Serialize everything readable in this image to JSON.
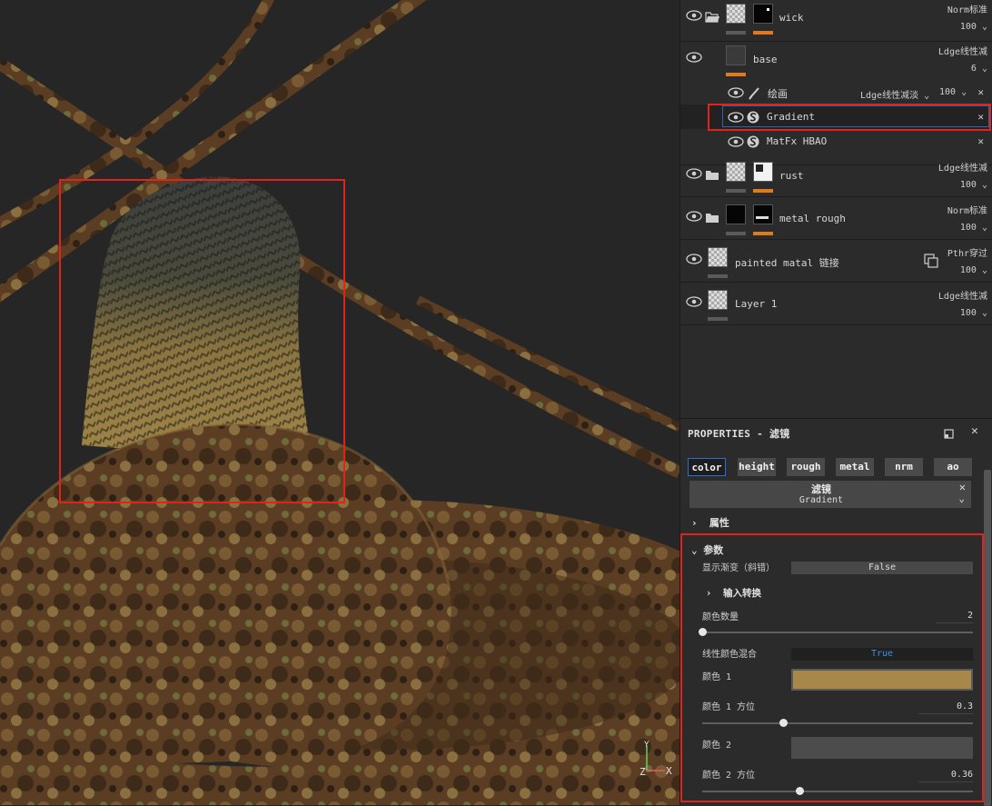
{
  "layers": [
    {
      "name": "wick",
      "blend": "Norm标准",
      "opacity": "100"
    },
    {
      "name": "base",
      "blend": "Ldge线性减",
      "opacity": "6"
    },
    {
      "name": "rust",
      "blend": "Ldge线性减",
      "opacity": "100"
    },
    {
      "name": "metal rough",
      "blend": "Norm标准",
      "opacity": "100"
    },
    {
      "name": "painted matal 链接",
      "blend": "Pthr穿过",
      "opacity": "100"
    },
    {
      "name": "Layer 1",
      "blend": "Ldge线性减",
      "opacity": "100"
    }
  ],
  "sublayers": [
    {
      "name": "绘画",
      "blend": "Ldge线性减淡",
      "opacity": "100"
    },
    {
      "name": "Gradient"
    },
    {
      "name": "MatFx HBAO"
    }
  ],
  "properties": {
    "title": "PROPERTIES - 滤镜",
    "channels": [
      "color",
      "height",
      "rough",
      "metal",
      "nrm",
      "ao"
    ],
    "filter_label": "滤镜",
    "filter_name": "Gradient",
    "section_attributes": "属性",
    "section_params": "参数",
    "show_gradient_label": "显示渐变（斜错）",
    "show_gradient_value": "False",
    "input_transform_label": "输入转换",
    "color_count_label": "颜色数量",
    "color_count_value": "2",
    "linear_blend_label": "线性颜色混合",
    "linear_blend_value": "True",
    "color1_label": "颜色 1",
    "color1_pos_label": "颜色 1 方位",
    "color1_pos_value": "0.3",
    "color2_label": "颜色 2",
    "color2_pos_label": "颜色 2 方位",
    "color2_pos_value": "0.36"
  },
  "sliders": {
    "color_count": 0.0,
    "color1_pos": 0.3,
    "color2_pos": 0.36
  },
  "colors": {
    "color1": "#a8884a",
    "color2": "#4c4c4c",
    "accent": "#e07a1f",
    "highlight": "#e0231b",
    "true_text": "#3f8fe8"
  },
  "gizmo": {
    "y": "Y",
    "z": "Z",
    "x": "X"
  }
}
